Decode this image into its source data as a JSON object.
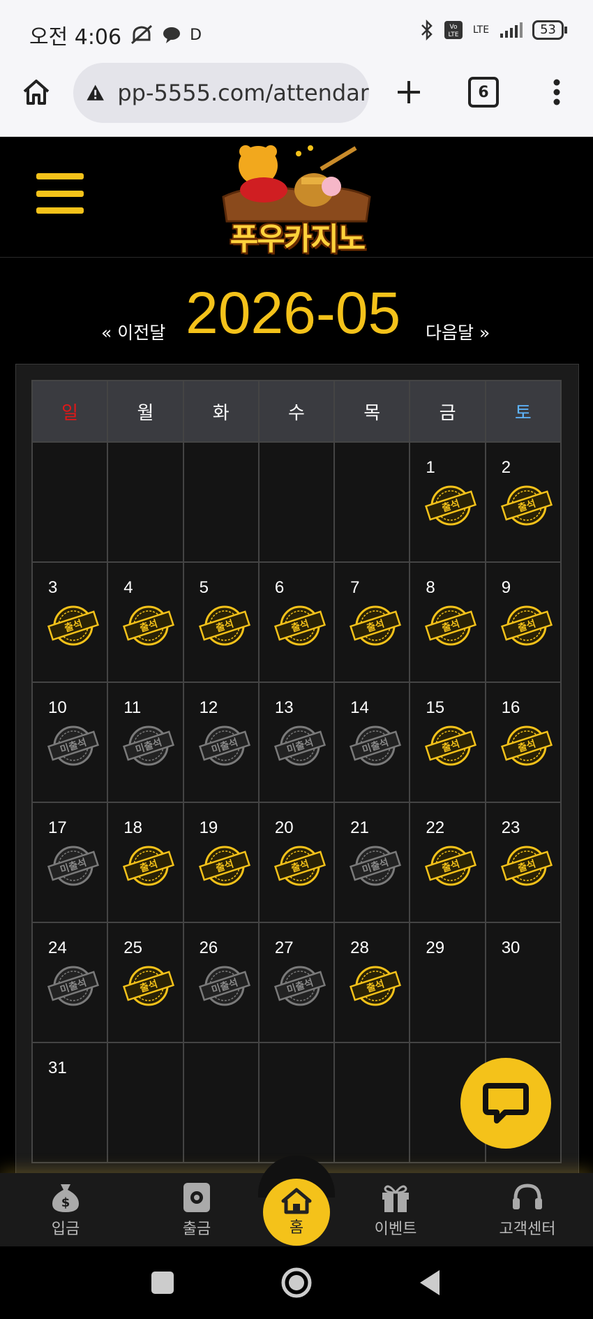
{
  "status_bar": {
    "time": "오전 4:06",
    "extra": "D",
    "network": "LTE",
    "battery": "53"
  },
  "browser": {
    "url": "pp-5555.com/attendar",
    "tab_count": "6"
  },
  "site": {
    "logo_text": "푸우카지노",
    "accent_color": "#f4c21a"
  },
  "calendar": {
    "prev_label": "« 이전달",
    "month": "2026-05",
    "next_label": "다음달 »",
    "weekdays": [
      "일",
      "월",
      "화",
      "수",
      "목",
      "금",
      "토"
    ],
    "present_label": "출석",
    "absent_label": "미출석",
    "weeks": [
      [
        null,
        null,
        null,
        null,
        null,
        {
          "day": "1",
          "status": "present"
        },
        {
          "day": "2",
          "status": "present"
        }
      ],
      [
        {
          "day": "3",
          "status": "present"
        },
        {
          "day": "4",
          "status": "present"
        },
        {
          "day": "5",
          "status": "present"
        },
        {
          "day": "6",
          "status": "present"
        },
        {
          "day": "7",
          "status": "present"
        },
        {
          "day": "8",
          "status": "present"
        },
        {
          "day": "9",
          "status": "present"
        }
      ],
      [
        {
          "day": "10",
          "status": "absent"
        },
        {
          "day": "11",
          "status": "absent"
        },
        {
          "day": "12",
          "status": "absent"
        },
        {
          "day": "13",
          "status": "absent"
        },
        {
          "day": "14",
          "status": "absent"
        },
        {
          "day": "15",
          "status": "present"
        },
        {
          "day": "16",
          "status": "present"
        }
      ],
      [
        {
          "day": "17",
          "status": "absent"
        },
        {
          "day": "18",
          "status": "present"
        },
        {
          "day": "19",
          "status": "present"
        },
        {
          "day": "20",
          "status": "present"
        },
        {
          "day": "21",
          "status": "absent"
        },
        {
          "day": "22",
          "status": "present"
        },
        {
          "day": "23",
          "status": "present"
        }
      ],
      [
        {
          "day": "24",
          "status": "absent"
        },
        {
          "day": "25",
          "status": "present"
        },
        {
          "day": "26",
          "status": "absent"
        },
        {
          "day": "27",
          "status": "absent"
        },
        {
          "day": "28",
          "status": "present"
        },
        {
          "day": "29",
          "status": "none"
        },
        {
          "day": "30",
          "status": "none"
        }
      ],
      [
        {
          "day": "31",
          "status": "none"
        },
        null,
        null,
        null,
        null,
        null,
        null
      ]
    ]
  },
  "bottom_nav": {
    "deposit": "입금",
    "withdraw": "출금",
    "home": "홈",
    "event": "이벤트",
    "support": "고객센터"
  }
}
